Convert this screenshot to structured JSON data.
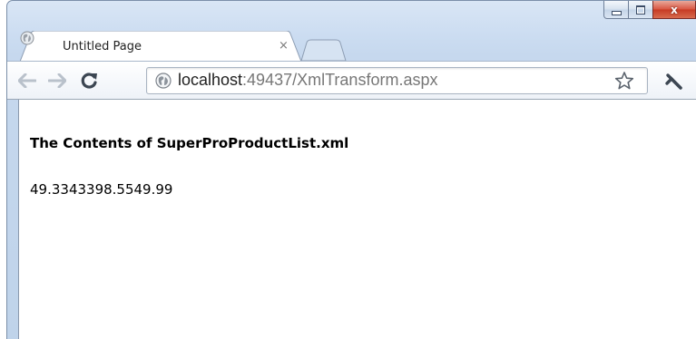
{
  "window": {
    "caption_buttons": {
      "minimize_icon": "minimize-icon",
      "maximize_icon": "maximize-icon",
      "close_label": "x"
    }
  },
  "tabs": [
    {
      "title": "Untitled Page",
      "close_label": "×",
      "icon": "globe-icon"
    }
  ],
  "toolbar": {
    "back_icon": "back-arrow-icon",
    "forward_icon": "forward-arrow-icon",
    "reload_icon": "reload-icon",
    "address": {
      "host": "localhost",
      "path": ":49437/XmlTransform.aspx"
    },
    "bookmark_icon": "star-icon",
    "menu_icon": "wrench-icon"
  },
  "page": {
    "heading": "The Contents of SuperProProductList.xml",
    "body_text": "49.3343398.5549.99"
  },
  "colors": {
    "frame": "#c6d8ee",
    "close_button": "#c63a23",
    "url_host": "#222222",
    "url_path": "#777777"
  }
}
